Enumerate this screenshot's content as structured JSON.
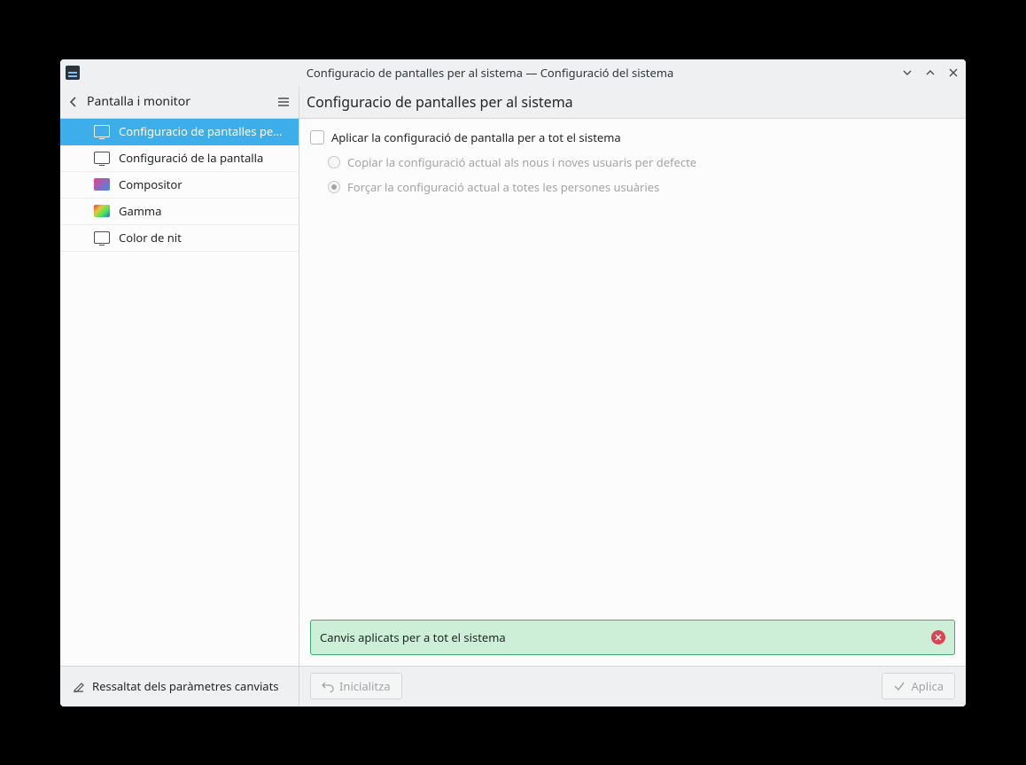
{
  "titlebar": {
    "title": "Configuracio de pantalles per al sistema — Configuració del sistema"
  },
  "sidebar": {
    "back_label": "Pantalla i monitor",
    "items": [
      {
        "label": "Configuracio de pantalles pe…"
      },
      {
        "label": "Configuració de la pantalla"
      },
      {
        "label": "Compositor"
      },
      {
        "label": "Gamma"
      },
      {
        "label": "Color de nit"
      }
    ],
    "footer_label": "Ressaltat dels paràmetres canviats"
  },
  "main": {
    "heading": "Configuracio de pantalles per al sistema",
    "checkbox_label": "Aplicar la configuració de pantalla per a tot el sistema",
    "radio1_label": "Copiar la configuració actual als nous i noves usuaris per defecte",
    "radio2_label": "Forçar la configuració actual a totes les persones usuàries",
    "notification_text": "Canvis aplicats per a tot el sistema",
    "reset_button": "Inicialitza",
    "apply_button": "Aplica"
  }
}
